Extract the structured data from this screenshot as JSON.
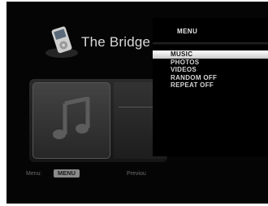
{
  "app": {
    "title": "The Bridge",
    "icon": "ipod-icon"
  },
  "content": {
    "album_icon": "music-note-icon"
  },
  "footer": {
    "menu_label": "Menu:",
    "menu_button": "MENU",
    "previous_label": "Previou"
  },
  "menu": {
    "title": "MENU",
    "selected_index": 0,
    "items": [
      {
        "label": "MUSIC"
      },
      {
        "label": "PHOTOS"
      },
      {
        "label": "VIDEOS"
      },
      {
        "label": "RANDOM OFF"
      },
      {
        "label": "REPEAT OFF"
      }
    ]
  },
  "colors": {
    "background": "#050505",
    "highlight": "#e6e6e6",
    "text": "#d6d6d6"
  }
}
